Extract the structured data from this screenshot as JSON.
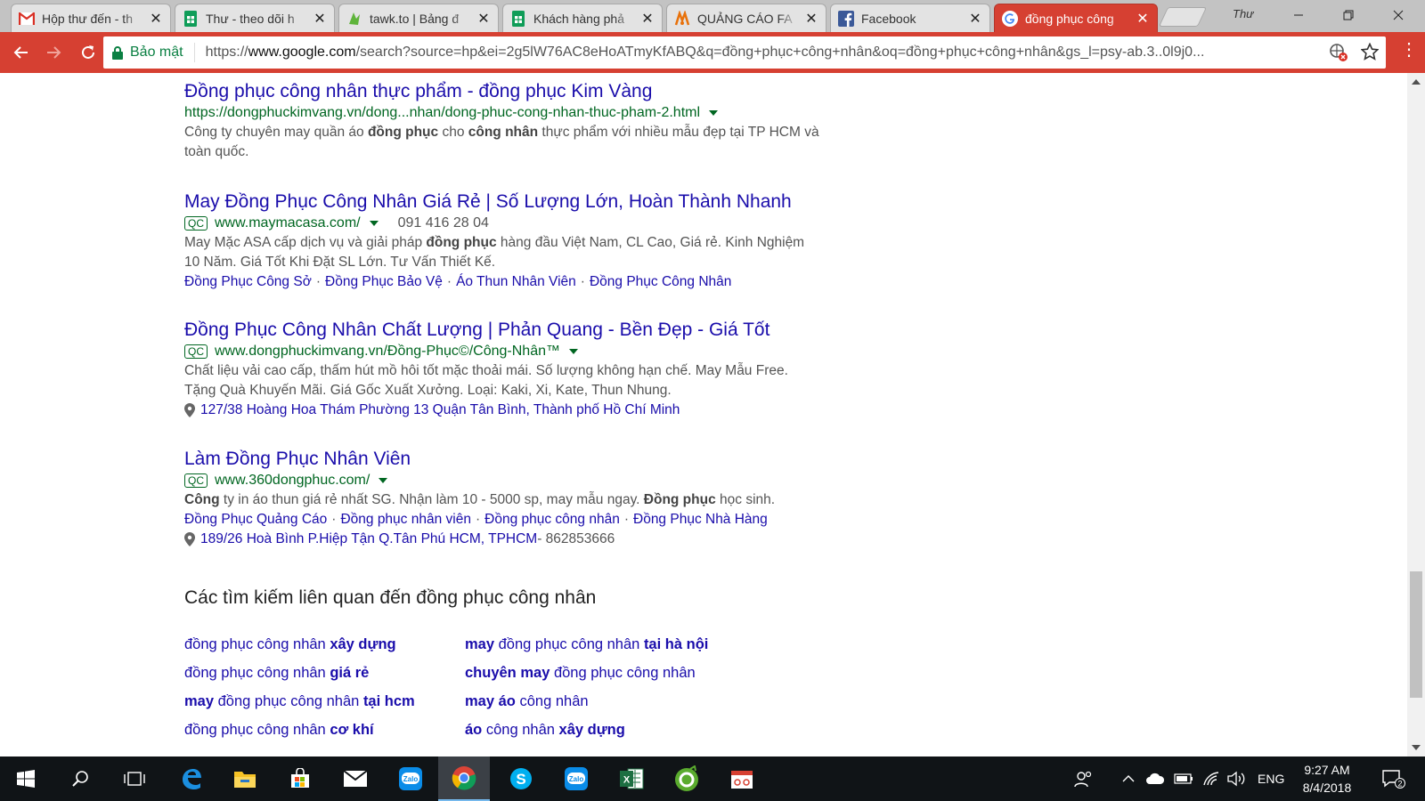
{
  "browser": {
    "tabs": [
      {
        "title": "Hộp thư đến - th",
        "icon": "gmail-icon",
        "active": false
      },
      {
        "title": "Thư - theo dõi h",
        "icon": "sheets-icon",
        "active": false
      },
      {
        "title": "tawk.to | Bảng đ",
        "icon": "tawkto-icon",
        "active": false
      },
      {
        "title": "Khách hàng phả",
        "icon": "sheets-icon",
        "active": false
      },
      {
        "title": "QUẢNG CÁO FA",
        "icon": "ads-icon",
        "active": false
      },
      {
        "title": "Facebook",
        "icon": "facebook-icon",
        "active": false
      },
      {
        "title": "đồng phục công",
        "icon": "google-icon",
        "active": true
      }
    ],
    "profile_label": "Thư",
    "accent_color": "#d64032",
    "address_bar": {
      "secure_label": "Bảo mật",
      "url_prefix": "https://",
      "url_domain": "www.google.com",
      "url_rest": "/search?source=hp&ei=2g5lW76AC8eHoATmyKfABQ&q=đồng+phục+công+nhân&oq=đồng+phục+công+nhân&gs_l=psy-ab.3..0l9j0..."
    }
  },
  "results": [
    {
      "title": "Đồng phục công nhân thực phẩm - đồng phục Kim Vàng",
      "ad": false,
      "url": "https://dongphuckimvang.vn/dong...nhan/dong-phuc-cong-nhan-thuc-pham-2.html",
      "desc_line1": [
        "Công ty chuyên may quần áo ",
        "đồng phục",
        " cho ",
        "công nhân",
        " thực phẩm với nhiều mẫu đẹp tại TP HCM và"
      ],
      "desc_line2": "toàn quốc."
    },
    {
      "title": "May Đồng Phục Công Nhân Giá Rẻ | Số Lượng Lớn, Hoàn Thành Nhanh",
      "ad": true,
      "ad_label": "QC",
      "url": "www.maymacasa.com/",
      "phone": "091 416 28 04",
      "desc_line1": [
        "May Mặc ASA cấp dịch vụ và giải pháp ",
        "đồng phục",
        " hàng đầu Việt Nam, CL Cao, Giá rẻ. Kinh Nghiệm"
      ],
      "desc_line2": "10 Năm. Giá Tốt Khi Đặt SL Lớn. Tư Vấn Thiết Kế.",
      "sitelinks": [
        "Đồng Phục Công Sở",
        "Đồng Phục Bảo Vệ",
        "Áo Thun Nhân Viên",
        "Đồng Phục Công Nhân"
      ]
    },
    {
      "title": "Đồng Phục Công Nhân Chất Lượng | Phản Quang - Bền Đẹp - Giá Tốt",
      "ad": true,
      "ad_label": "QC",
      "url": "www.dongphuckimvang.vn/Đồng-Phục©/Công-Nhân™",
      "desc_line1": "Chất liệu vải cao cấp, thấm hút mồ hôi tốt mặc thoải mái. Số lượng không hạn chế. May Mẫu Free.",
      "desc_line2": "Tặng Quà Khuyến Mãi. Giá Gốc Xuất Xưởng. Loại: Kaki, Xi, Kate, Thun Nhung.",
      "address": "127/38 Hoàng Hoa Thám Phường 13 Quận Tân Bình, Thành phố Hồ Chí Minh"
    },
    {
      "title": "Làm Đồng Phục Nhân Viên",
      "ad": true,
      "ad_label": "QC",
      "url": "www.360dongphuc.com/",
      "desc_line1": [
        "Công",
        " ty in áo thun giá rẻ nhất SG. Nhận làm 10 - 5000 sp, may mẫu ngay. ",
        "Đồng phục",
        " học sinh."
      ],
      "sitelinks": [
        "Đồng Phục Quảng Cáo",
        "Đồng phục nhân viên",
        "Đồng phục công nhân",
        "Đồng Phục Nhà Hàng"
      ],
      "address": "189/26 Hoà Bình P.Hiệp Tận Q.Tân Phú HCM, TPHCM",
      "address_extra": " - 862853666"
    }
  ],
  "related": {
    "heading": "Các tìm kiếm liên quan đến đồng phục công nhân",
    "left": [
      [
        [
          "đồng phục công nhân ",
          false
        ],
        [
          "xây dựng",
          true
        ]
      ],
      [
        [
          "đồng phục công nhân ",
          false
        ],
        [
          "giá rẻ",
          true
        ]
      ],
      [
        [
          "may",
          true
        ],
        [
          " đồng phục công nhân ",
          false
        ],
        [
          "tại hcm",
          true
        ]
      ],
      [
        [
          "đồng phục công nhân ",
          false
        ],
        [
          "cơ khí",
          true
        ]
      ]
    ],
    "right": [
      [
        [
          "may",
          true
        ],
        [
          " đồng phục công nhân ",
          false
        ],
        [
          "tại hà nội",
          true
        ]
      ],
      [
        [
          "chuyên may",
          true
        ],
        [
          " đồng phục công nhân",
          false
        ]
      ],
      [
        [
          "may",
          true
        ],
        [
          " ",
          false
        ],
        [
          "áo",
          true
        ],
        [
          " công nhân",
          false
        ]
      ],
      [
        [
          "áo",
          true
        ],
        [
          " công nhân ",
          false
        ],
        [
          "xây dựng",
          true
        ]
      ]
    ]
  },
  "taskbar": {
    "apps": [
      "windows-start-icon",
      "search-icon",
      "task-view-icon",
      "edge-icon",
      "file-explorer-icon",
      "store-icon",
      "mail-icon",
      "zalo-icon",
      "chrome-icon",
      "skype-icon",
      "zalo-icon",
      "excel-icon",
      "coccoc-icon",
      "snipping-icon"
    ],
    "tray_lang": "ENG",
    "time": "9:27 AM",
    "date": "8/4/2018",
    "notification_count": "2"
  }
}
